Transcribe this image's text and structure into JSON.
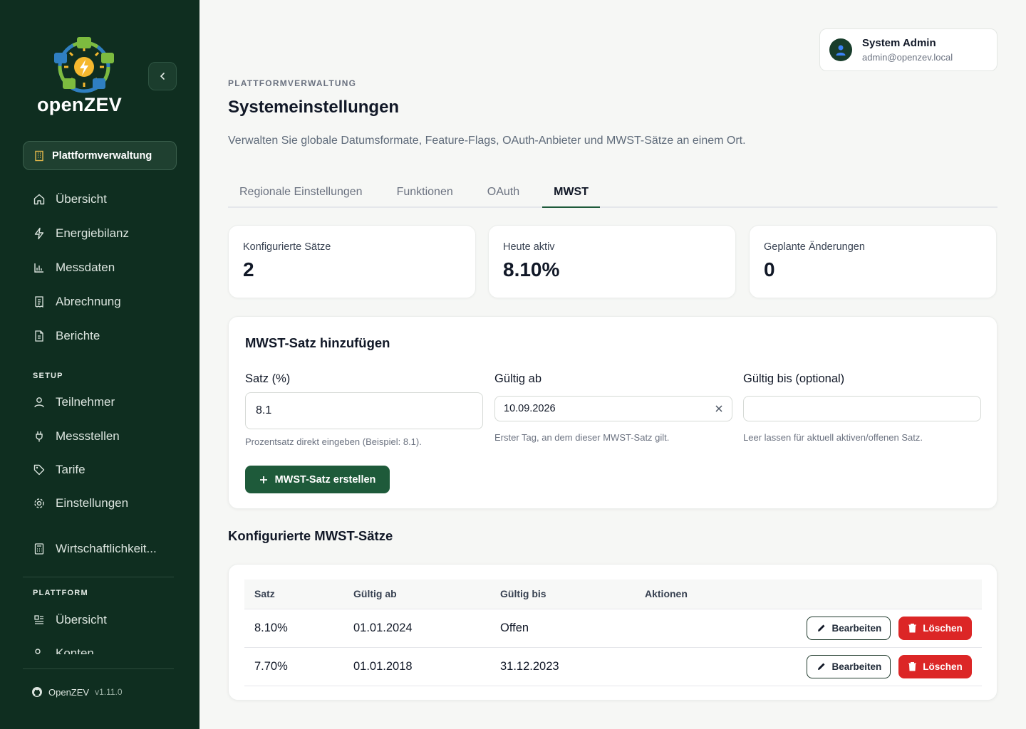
{
  "sidebar": {
    "logo_text": "openZEV",
    "platform_pill": "Plattformverwaltung",
    "nav": [
      {
        "label": "Übersicht",
        "icon": "home-icon"
      },
      {
        "label": "Energiebilanz",
        "icon": "bolt-icon"
      },
      {
        "label": "Messdaten",
        "icon": "bar-chart-icon"
      },
      {
        "label": "Abrechnung",
        "icon": "receipt-icon"
      },
      {
        "label": "Berichte",
        "icon": "document-icon"
      }
    ],
    "setup_label": "SETUP",
    "setup": [
      {
        "label": "Teilnehmer",
        "icon": "user-icon"
      },
      {
        "label": "Messstellen",
        "icon": "plug-icon"
      },
      {
        "label": "Tarife",
        "icon": "tag-icon"
      },
      {
        "label": "Einstellungen",
        "icon": "settings-icon"
      }
    ],
    "extra_item": "Wirtschaftlichkeit...",
    "plattform_label": "PLATTFORM",
    "plattform": [
      {
        "label": "Übersicht",
        "icon": "layout-icon"
      },
      {
        "label": "Konten",
        "icon": "users-icon"
      }
    ],
    "footer": {
      "name": "OpenZEV",
      "version": "v1.11.0"
    }
  },
  "user": {
    "name": "System Admin",
    "email": "admin@openzev.local"
  },
  "header": {
    "eyebrow": "PLATTFORMVERWALTUNG",
    "title": "Systemeinstellungen",
    "description": "Verwalten Sie globale Datumsformate, Feature-Flags, OAuth-Anbieter und MWST-Sätze an einem Ort."
  },
  "tabs": [
    "Regionale Einstellungen",
    "Funktionen",
    "OAuth",
    "MWST"
  ],
  "stats": [
    {
      "label": "Konfigurierte Sätze",
      "value": "2"
    },
    {
      "label": "Heute aktiv",
      "value": "8.10%"
    },
    {
      "label": "Geplante Änderungen",
      "value": "0"
    }
  ],
  "form": {
    "title": "MWST-Satz hinzufügen",
    "rate_label": "Satz (%)",
    "rate_value": "8.1",
    "rate_hint": "Prozentsatz direkt eingeben (Beispiel: 8.1).",
    "from_label": "Gültig ab",
    "from_value": "10.09.2026",
    "from_hint": "Erster Tag, an dem dieser MWST-Satz gilt.",
    "to_label": "Gültig bis (optional)",
    "to_value": "",
    "to_hint": "Leer lassen für aktuell aktiven/offenen Satz.",
    "submit": "MWST-Satz erstellen"
  },
  "table": {
    "title": "Konfigurierte MWST-Sätze",
    "headers": [
      "Satz",
      "Gültig ab",
      "Gültig bis",
      "Aktionen"
    ],
    "rows": [
      {
        "rate": "8.10%",
        "from": "01.01.2024",
        "to": "Offen"
      },
      {
        "rate": "7.70%",
        "from": "01.01.2018",
        "to": "31.12.2023"
      }
    ],
    "edit_label": "Bearbeiten",
    "delete_label": "Löschen"
  },
  "colors": {
    "sidebar_bg": "#0f2e20",
    "primary": "#1e5a3a",
    "danger": "#dc2626"
  }
}
